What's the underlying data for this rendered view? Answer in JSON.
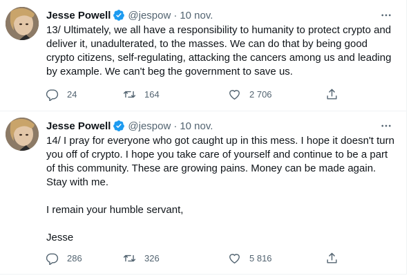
{
  "tweets": [
    {
      "name": "Jesse Powell",
      "handle": "@jespow",
      "separator": "·",
      "time": "10 nov.",
      "paragraphs": [
        "13/ Ultimately, we all have a responsibility to humanity to protect crypto and deliver it, unadulterated, to the masses. We can do that by being good crypto citizens, self-regulating, attacking the cancers among us and leading by example. We can't beg the government to save us."
      ],
      "replies": "24",
      "retweets": "164",
      "likes": "2 706"
    },
    {
      "name": "Jesse Powell",
      "handle": "@jespow",
      "separator": "·",
      "time": "10 nov.",
      "paragraphs": [
        "14/ I pray for everyone who got caught up in this mess. I hope it doesn't turn you off of crypto. I hope you take care of yourself and continue to be a part of this community. These are growing pains. Money can be made again. Stay with me.",
        "I remain your humble servant,",
        "Jesse"
      ],
      "replies": "286",
      "retweets": "326",
      "likes": "5 816"
    }
  ],
  "icons": {
    "avatar": "avatar-photo",
    "verified": "verified-badge-icon",
    "more": "more-icon",
    "reply": "reply-icon",
    "retweet": "retweet-icon",
    "like": "like-icon",
    "share": "share-icon"
  },
  "colors": {
    "text": "#0f1419",
    "muted": "#536471",
    "verified": "#1d9bf0",
    "divider": "#eff3f4"
  }
}
